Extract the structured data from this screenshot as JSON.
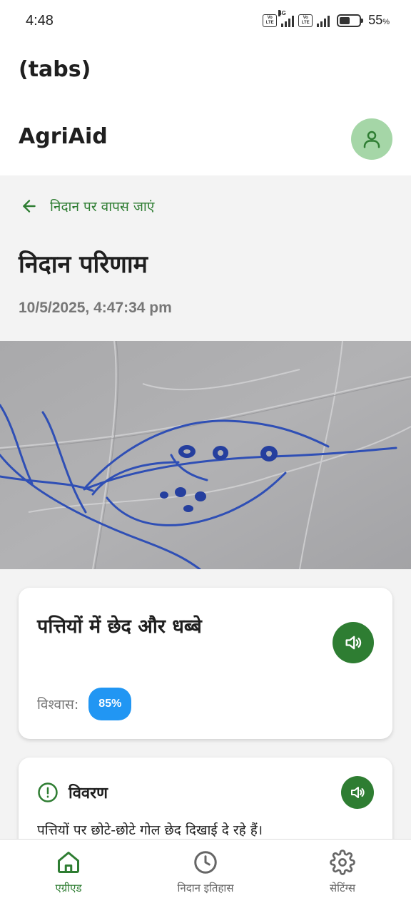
{
  "status_bar": {
    "time": "4:48",
    "network": "4G",
    "volte_label": "Vo LTE",
    "battery_percent": "55",
    "battery_unit": "%",
    "battery_level": 0.55
  },
  "tabs_header": {
    "title": "(tabs)"
  },
  "app_header": {
    "title": "AgriAid"
  },
  "back_link": {
    "label": "निदान पर वापस जाएं"
  },
  "page": {
    "title": "निदान परिणाम",
    "timestamp": "10/5/2025, 4:47:34 pm"
  },
  "result": {
    "disease_name": "पत्तियों में छेद और धब्बे",
    "confidence_label": "विश्वास:",
    "confidence_value": "85%"
  },
  "description": {
    "title": "विवरण",
    "text": "पत्तियों पर छोटे-छोटे गोल छेद दिखाई दे रहे हैं।"
  },
  "bottom_nav": {
    "items": [
      {
        "label": "एग्रीएड",
        "icon": "home-icon",
        "active": true
      },
      {
        "label": "निदान इतिहास",
        "icon": "history-clock-icon",
        "active": false
      },
      {
        "label": "सेटिंग्स",
        "icon": "settings-gear-icon",
        "active": false
      }
    ]
  },
  "colors": {
    "primary_green": "#2e7d32",
    "avatar_bg": "#a5d6a7",
    "badge_blue": "#2196f3"
  }
}
